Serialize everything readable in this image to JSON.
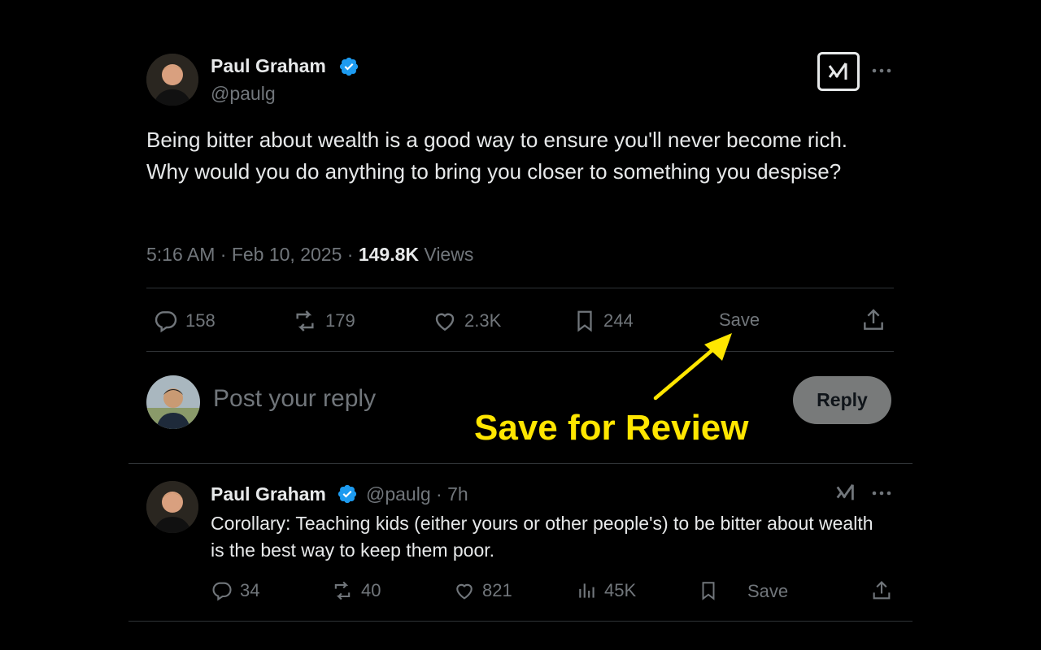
{
  "main_tweet": {
    "author_name": "Paul Graham",
    "author_handle": "@paulg",
    "text": "Being bitter about wealth is a good way to ensure you'll never become rich. Why would you do anything to bring you closer to something you despise?",
    "time": "5:16 AM · Feb 10, 2025 · ",
    "views_count": "149.8K",
    "views_label": " Views",
    "actions": {
      "replies": "158",
      "reposts": "179",
      "likes": "2.3K",
      "bookmarks": "244",
      "save_label": "Save"
    }
  },
  "reply_box": {
    "placeholder": "Post your reply",
    "button_label": "Reply"
  },
  "annotation": {
    "text": "Save for Review",
    "color": "#ffe600"
  },
  "reply_tweet": {
    "author_name": "Paul Graham",
    "author_handle": "@paulg · 7h",
    "text": "Corollary: Teaching kids (either yours or other people's) to be bitter about wealth is the best way to keep them poor.",
    "actions": {
      "replies": "34",
      "reposts": "40",
      "likes": "821",
      "views": "45K",
      "save_label": "Save"
    }
  },
  "colors": {
    "background": "#000000",
    "text": "#e7e9ea",
    "muted": "#71767b",
    "verified": "#1d9bf0",
    "divider": "#2f3336"
  }
}
